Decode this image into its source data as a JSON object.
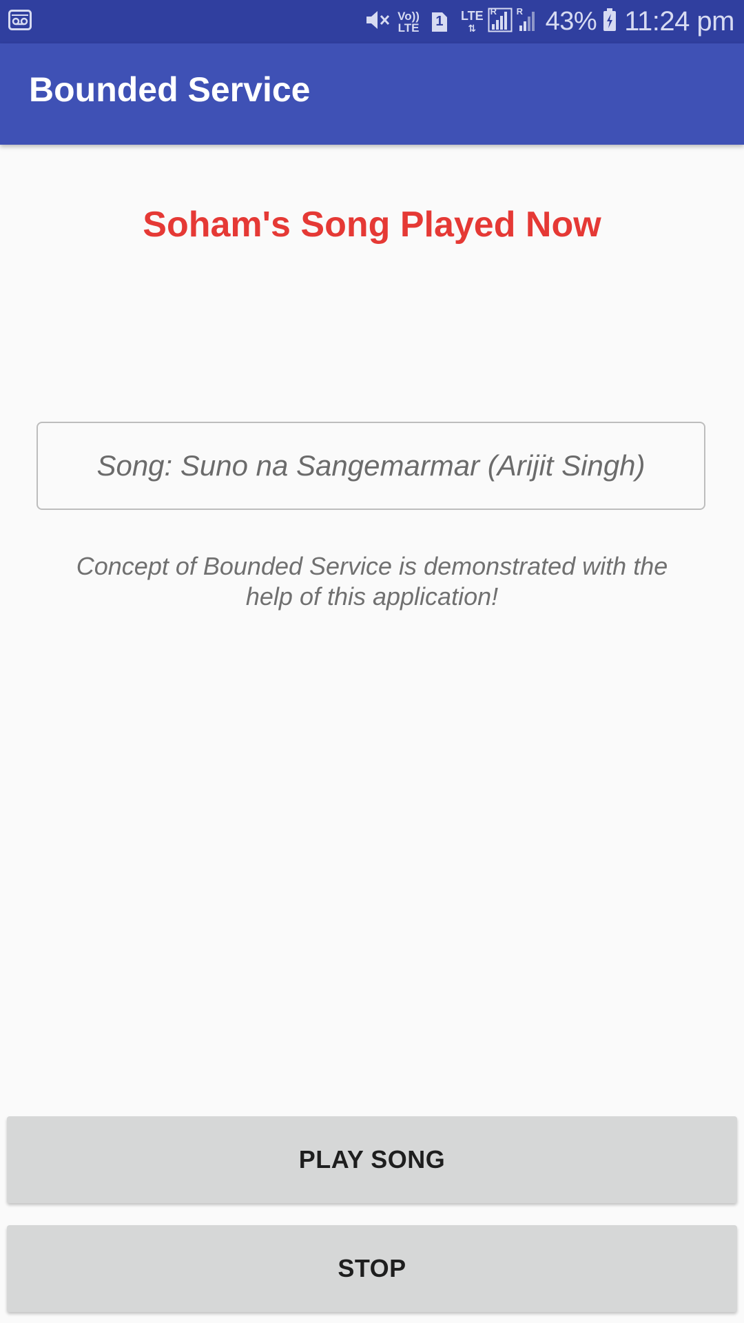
{
  "status_bar": {
    "icons": [
      "voicemail-icon",
      "mute-icon",
      "volte-icon",
      "sim-1-icon",
      "lte-icon",
      "signal-icon",
      "signal-icon",
      "battery-charging-icon"
    ],
    "volte_label_top": "Vo))",
    "volte_label_bottom": "LTE",
    "sim_label": "1",
    "lte_label": "LTE",
    "roaming_label": "R",
    "battery_percent": "43%",
    "time": "11:24 pm"
  },
  "app_bar": {
    "title": "Bounded Service"
  },
  "main": {
    "heading": "Soham's Song Played Now",
    "song_label": "Song: Suno na Sangemarmar (Arijit Singh)",
    "description": "Concept of Bounded Service is demonstrated with the help of this application!"
  },
  "buttons": {
    "play_label": "PLAY SONG",
    "stop_label": "STOP"
  },
  "colors": {
    "status_bar": "#303f9f",
    "app_bar": "#3f51b5",
    "heading": "#e53935",
    "button_bg": "#d6d7d7"
  }
}
